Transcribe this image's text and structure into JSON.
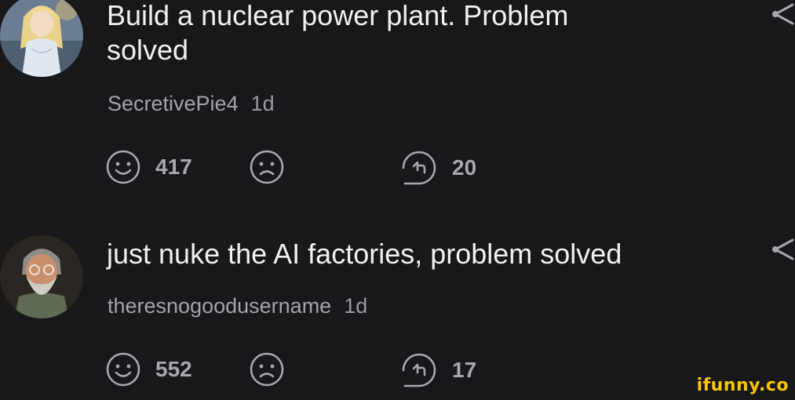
{
  "comments": [
    {
      "text": "Build a nuclear power plant. Problem\nsolved",
      "username": "SecretivePie4",
      "time": "1d",
      "likes": "417",
      "replies": "20",
      "avatar_icon": "anime-girl-avatar"
    },
    {
      "text": "just nuke the AI factories, problem solved",
      "username": "theresnogoodusername",
      "time": "1d",
      "likes": "552",
      "replies": "17",
      "avatar_icon": "bearded-man-avatar"
    }
  ],
  "watermark": "ifunny.co",
  "colors": {
    "background": "#18181b",
    "text": "#f0f0f0",
    "secondary": "#a3a3a8",
    "watermark": "#f7c600"
  }
}
